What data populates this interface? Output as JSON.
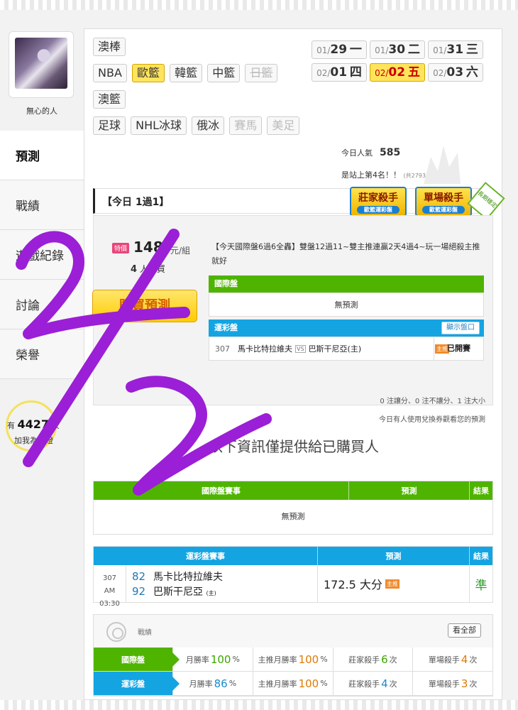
{
  "user": {
    "name": "無心的人"
  },
  "nav": [
    {
      "label": "預測",
      "active": true
    },
    {
      "label": "戰績"
    },
    {
      "label": "遊戲紀錄"
    },
    {
      "label": "討論"
    },
    {
      "label": "榮譽"
    }
  ],
  "fans": {
    "prefix": "有",
    "count": "4427",
    "unit": "人",
    "sub": "加我為明燈"
  },
  "leagues": {
    "row1": [
      "澳棒"
    ],
    "row2": [
      "NBA",
      "歐籃",
      "韓籃",
      "中籃",
      "日籃"
    ],
    "row3": [
      "澳籃"
    ],
    "row4": [
      "足球",
      "NHL冰球",
      "俄冰",
      "賽馬",
      "美足"
    ]
  },
  "dates": [
    {
      "md": "01/",
      "d": "29",
      "wd": "一"
    },
    {
      "md": "01/",
      "d": "30",
      "wd": "二"
    },
    {
      "md": "01/",
      "d": "31",
      "wd": "三"
    },
    {
      "md": "02/",
      "d": "01",
      "wd": "四"
    },
    {
      "md": "02/",
      "d": "02",
      "wd": "五",
      "active": true
    },
    {
      "md": "02/",
      "d": "03",
      "wd": "六"
    }
  ],
  "popularity": {
    "label": "今日人氣",
    "value": "585",
    "rank": "是站上第4名！！",
    "rank_note": "(共2793人)"
  },
  "section": {
    "title": "【今日 1過1】",
    "badges": [
      {
        "title": "莊家殺手",
        "sub": "歐籃運彩盤"
      },
      {
        "title": "單場殺手",
        "sub": "歐籃運彩盤"
      }
    ],
    "ribbon": "長期穩定"
  },
  "card": {
    "tag": "特價",
    "price": "148",
    "price_unit": "元/組",
    "buyers_count": "4",
    "buyers_unit": "人購買",
    "buy_button": "購買預測",
    "description": "【今天國際盤6過6全轟】雙盤12過11~雙主推連贏2天4過4~玩一場絕殺主推就好",
    "intl_header": "國際盤",
    "intl_empty": "無預測",
    "lottery_header": "運彩盤",
    "show_button": "顯示盤口",
    "match": {
      "no": "307",
      "home": "馬卡比特拉維夫",
      "vs": "VS",
      "away": "巴斯干尼亞(主)",
      "tag": "主推",
      "status": "已開賽"
    },
    "note1": "0 注讓分、0 注不讓分、1 注大小",
    "note2": "今日有人使用兌換券觀看您的預測"
  },
  "buyers_only": "以下資訊僅提供給已購買人",
  "intl_table": {
    "headers": [
      "國際盤賽事",
      "預測",
      "結果"
    ],
    "empty": "無預測"
  },
  "lottery_table": {
    "headers": [
      "運彩盤賽事",
      "預測",
      "結果"
    ],
    "row": {
      "no": "307",
      "time": "AM 03:30",
      "score1": "82",
      "team1": "馬卡比特拉維夫",
      "score2": "92",
      "team2": "巴斯干尼亞",
      "team2_note": "(主)",
      "prediction": "172.5 大分",
      "tag": "主推",
      "result": "準"
    }
  },
  "record": {
    "title": "戰績",
    "view_all": "看全部",
    "rows": [
      {
        "label": "國際盤",
        "month_label": "月勝率",
        "month": "100",
        "main_label": "主推月勝率",
        "main": "100",
        "dealer_label": "莊家殺手",
        "dealer": "6",
        "single_label": "單場殺手",
        "single": "4"
      },
      {
        "label": "運彩盤",
        "month_label": "月勝率",
        "month": "86",
        "main_label": "主推月勝率",
        "main": "100",
        "dealer_label": "莊家殺手",
        "dealer": "4",
        "single_label": "單場殺手",
        "single": "3"
      }
    ],
    "pct": "%",
    "times": "次"
  },
  "annotation": {
    "text": "2/2",
    "color": "#9b1fd6"
  },
  "colors": {
    "green": "#4fb400",
    "blue": "#14a4e2",
    "yellow": "#ffe45c"
  }
}
